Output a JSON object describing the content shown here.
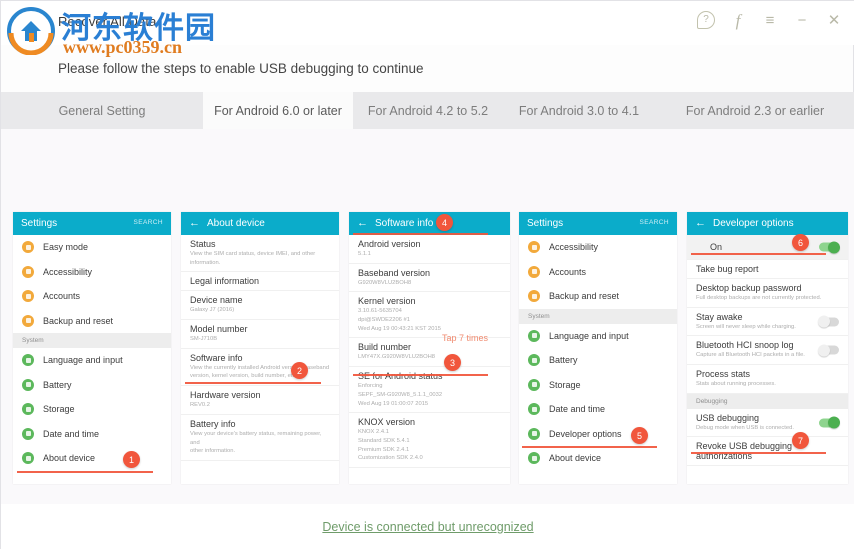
{
  "window": {
    "title": "Recover All Data",
    "subtitle": "Please follow the steps to enable USB debugging to continue",
    "controls": [
      {
        "name": "help-icon",
        "glyph": "?"
      },
      {
        "name": "facebook-icon",
        "glyph": "f"
      },
      {
        "name": "menu-icon",
        "glyph": "≡"
      },
      {
        "name": "minimize-icon",
        "glyph": "−"
      },
      {
        "name": "close-icon",
        "glyph": "✕"
      }
    ]
  },
  "watermark": {
    "cn": "河东软件园",
    "url": "www.pc0359.cn"
  },
  "tabs": [
    {
      "label": "General Setting",
      "active": false
    },
    {
      "label": "For Android 6.0 or later",
      "active": true
    },
    {
      "label": "For Android 4.2 to 5.2",
      "active": false
    },
    {
      "label": "For Android 3.0 to 4.1",
      "active": false
    },
    {
      "label": "For Android 2.3 or earlier",
      "active": false
    }
  ],
  "steps": [
    "1",
    "2",
    "3",
    "4",
    "5"
  ],
  "annotations": {
    "badge1": "1",
    "badge2": "2",
    "badge3": "3",
    "badge4": "4",
    "badge5": "5",
    "badge6": "6",
    "badge7": "7",
    "tap7": "Tap 7 times"
  },
  "panels": {
    "settings1": {
      "title": "Settings",
      "search": "SEARCH",
      "items": [
        {
          "label": "Easy mode",
          "color": "o"
        },
        {
          "label": "Accessibility",
          "color": "o"
        },
        {
          "label": "Accounts",
          "color": "o"
        },
        {
          "label": "Backup and reset",
          "color": "o"
        }
      ],
      "section": "System",
      "items2": [
        {
          "label": "Language and input",
          "color": "g"
        },
        {
          "label": "Battery",
          "color": "g"
        },
        {
          "label": "Storage",
          "color": "g"
        },
        {
          "label": "Date and time",
          "color": "g"
        },
        {
          "label": "About device",
          "color": "g"
        }
      ]
    },
    "about": {
      "title": "About device",
      "rows": [
        {
          "title": "Status",
          "sub": "View the SIM card status, device IMEI, and other\ninformation."
        },
        {
          "title": "Legal information",
          "sub": ""
        },
        {
          "title": "Device name",
          "sub": "Galaxy J7 (2016)"
        },
        {
          "title": "Model number",
          "sub": "SM-J710B"
        },
        {
          "title": "Software info",
          "sub": "View the currently installed Android version, baseband\nversion, kernel version, build number, etc."
        },
        {
          "title": "Hardware version",
          "sub": "REV0.2"
        },
        {
          "title": "Battery info",
          "sub": "View your device's battery status, remaining power, and\nother information."
        }
      ]
    },
    "software": {
      "title": "Software info",
      "rows": [
        {
          "title": "Android version",
          "sub": "5.1.1"
        },
        {
          "title": "Baseband version",
          "sub": "G920W8VLU2BOH8"
        },
        {
          "title": "Kernel version",
          "sub": "3.10.61-5635704\ndpi@SWDE2206 #1\nWed Aug 19 00:43:21 KST 2015"
        },
        {
          "title": "Build number",
          "sub": "LMY47X.G920W8VLU2BOH8"
        },
        {
          "title": "SE for Android status",
          "sub": "Enforcing\nSEPF_SM-G920W8_5.1.1_0032\nWed Aug 19 01:00:07 2015"
        },
        {
          "title": "KNOX version",
          "sub": "KNOX 2.4.1\nStandard SDK 5.4.1\nPremium SDK 2.4.1\nCustomization SDK 2.4.0"
        }
      ]
    },
    "settings2": {
      "title": "Settings",
      "search": "SEARCH",
      "items": [
        {
          "label": "Accessibility",
          "color": "o"
        },
        {
          "label": "Accounts",
          "color": "o"
        },
        {
          "label": "Backup and reset",
          "color": "o"
        }
      ],
      "section": "System",
      "items2": [
        {
          "label": "Language and input",
          "color": "g"
        },
        {
          "label": "Battery",
          "color": "g"
        },
        {
          "label": "Storage",
          "color": "g"
        },
        {
          "label": "Date and time",
          "color": "g"
        },
        {
          "label": "Developer options",
          "color": "g"
        },
        {
          "label": "About device",
          "color": "g"
        }
      ]
    },
    "developer": {
      "title": "Developer options",
      "on_label": "On",
      "on_state": true,
      "rows": [
        {
          "title": "Take bug report",
          "sub": "",
          "toggle": null
        },
        {
          "title": "Desktop backup password",
          "sub": "Full desktop backups are not currently protected.",
          "toggle": null
        },
        {
          "title": "Stay awake",
          "sub": "Screen will never sleep while charging.",
          "toggle": false
        },
        {
          "title": "Bluetooth HCI snoop log",
          "sub": "Capture all Bluetooth HCI packets in a file.",
          "toggle": false
        },
        {
          "title": "Process stats",
          "sub": "Stats about running processes.",
          "toggle": null
        }
      ],
      "section": "Debugging",
      "rows2": [
        {
          "title": "USB debugging",
          "sub": "Debug mode when USB is connected.",
          "toggle": true
        },
        {
          "title": "Revoke USB debugging authorizations",
          "sub": "",
          "toggle": null
        }
      ]
    }
  },
  "footer": {
    "link": "Device is connected but unrecognized"
  }
}
